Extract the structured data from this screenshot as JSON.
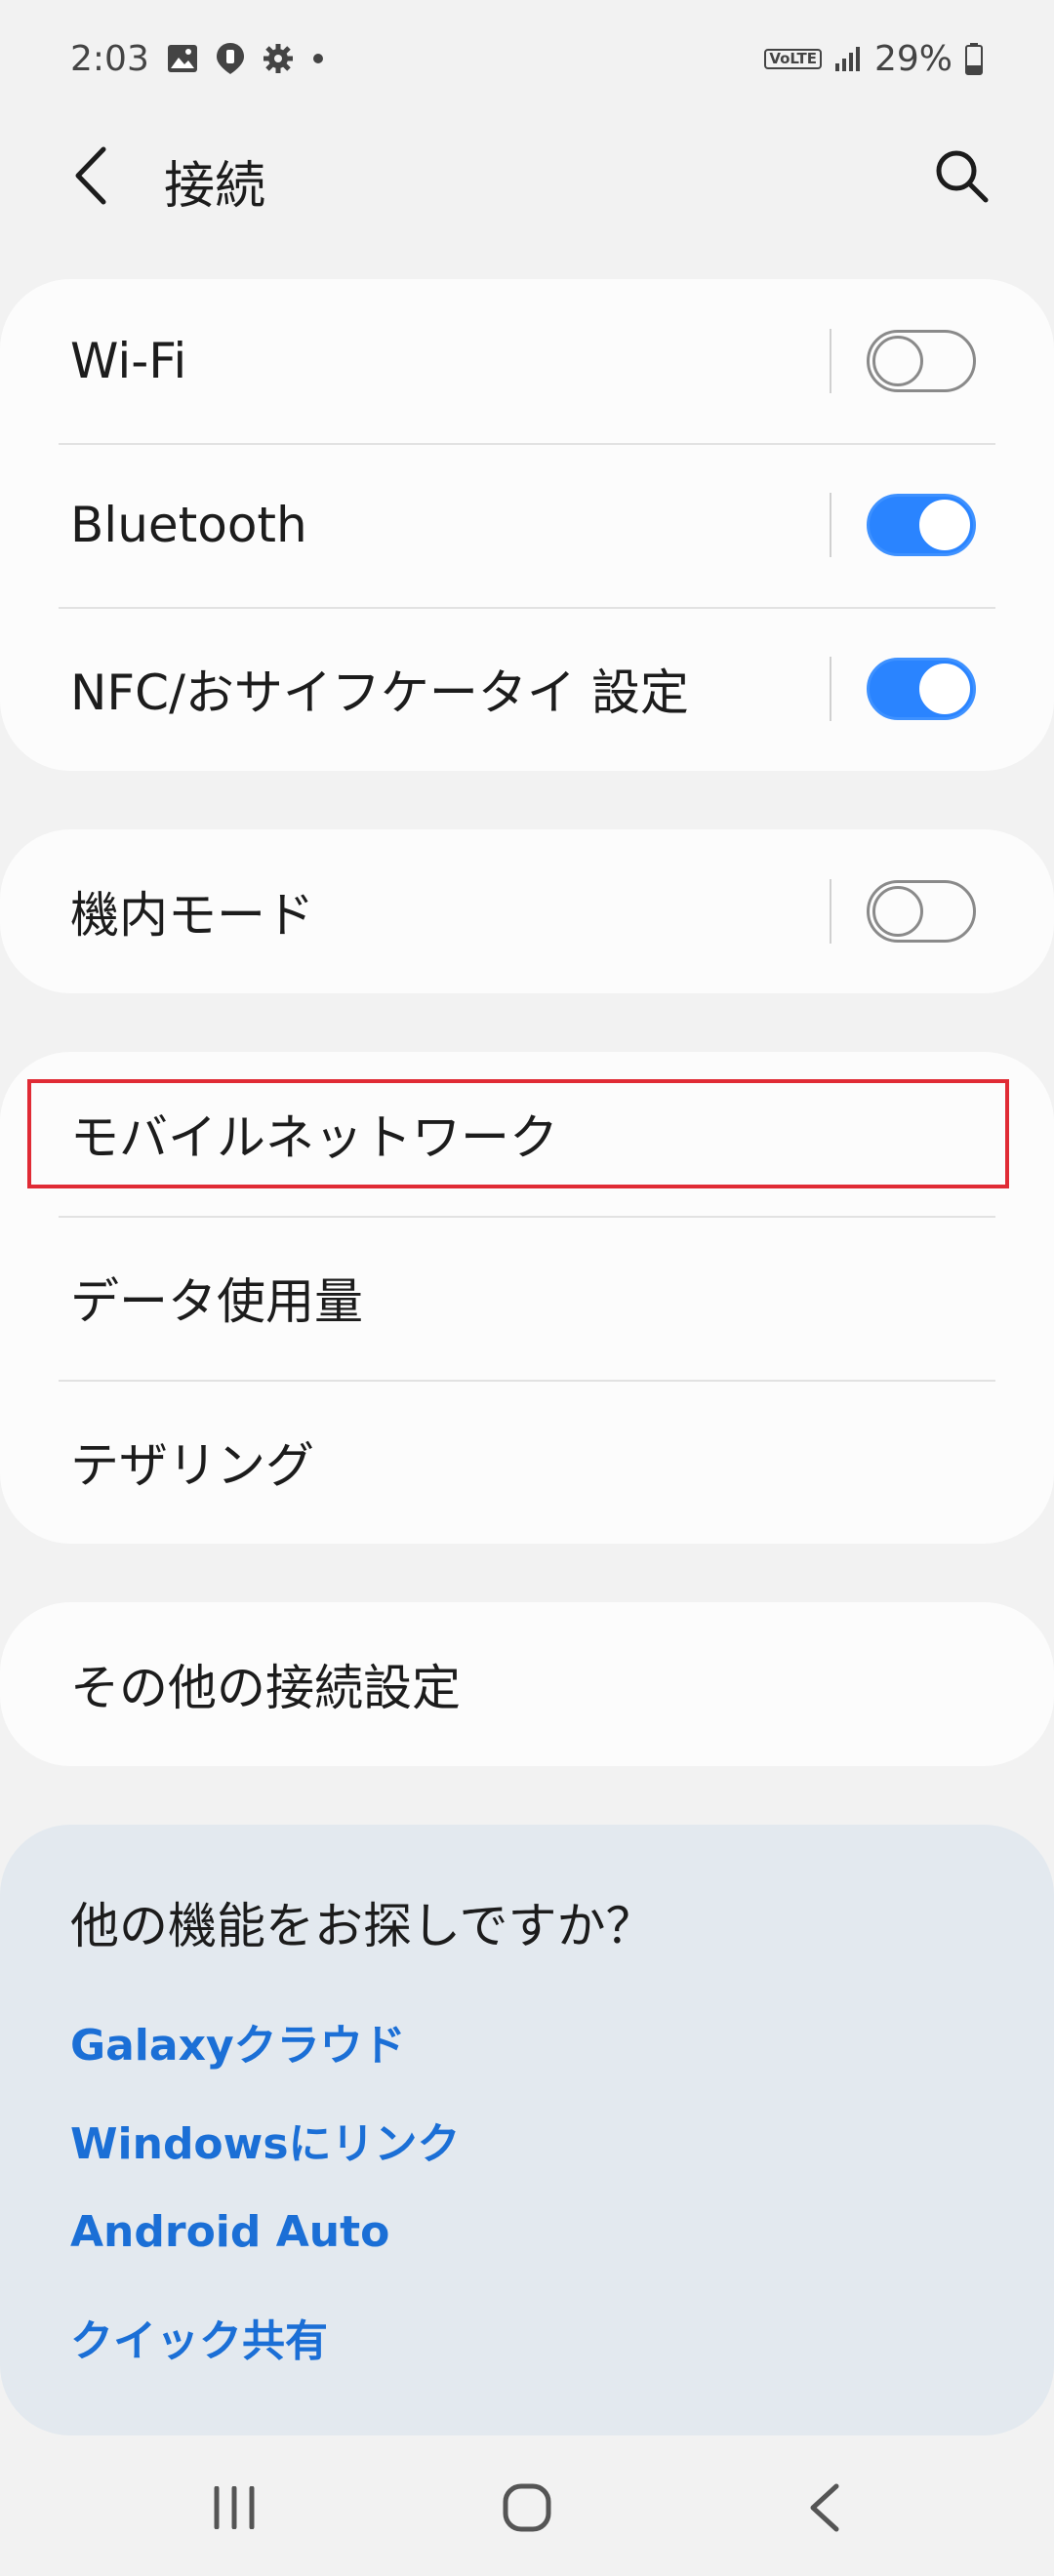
{
  "status_bar": {
    "time": "2:03",
    "battery": "29%",
    "volte": "VoLTE"
  },
  "header": {
    "title": "接続"
  },
  "group1": [
    {
      "label": "Wi-Fi",
      "toggle_on": false
    },
    {
      "label": "Bluetooth",
      "toggle_on": true
    },
    {
      "label": "NFC/おサイフケータイ 設定",
      "toggle_on": true
    }
  ],
  "group2": [
    {
      "label": "機内モード",
      "toggle_on": false
    }
  ],
  "group3": [
    {
      "label": "モバイルネットワーク"
    },
    {
      "label": "データ使用量"
    },
    {
      "label": "テザリング"
    }
  ],
  "group4": [
    {
      "label": "その他の接続設定"
    }
  ],
  "suggestions": {
    "title": "他の機能をお探しですか？",
    "links": [
      "Galaxyクラウド",
      "Windowsにリンク",
      "Android Auto",
      "クイック共有"
    ]
  },
  "colors": {
    "accent": "#2a84ff",
    "link": "#1b6fd6",
    "highlight": "#e02b35"
  }
}
